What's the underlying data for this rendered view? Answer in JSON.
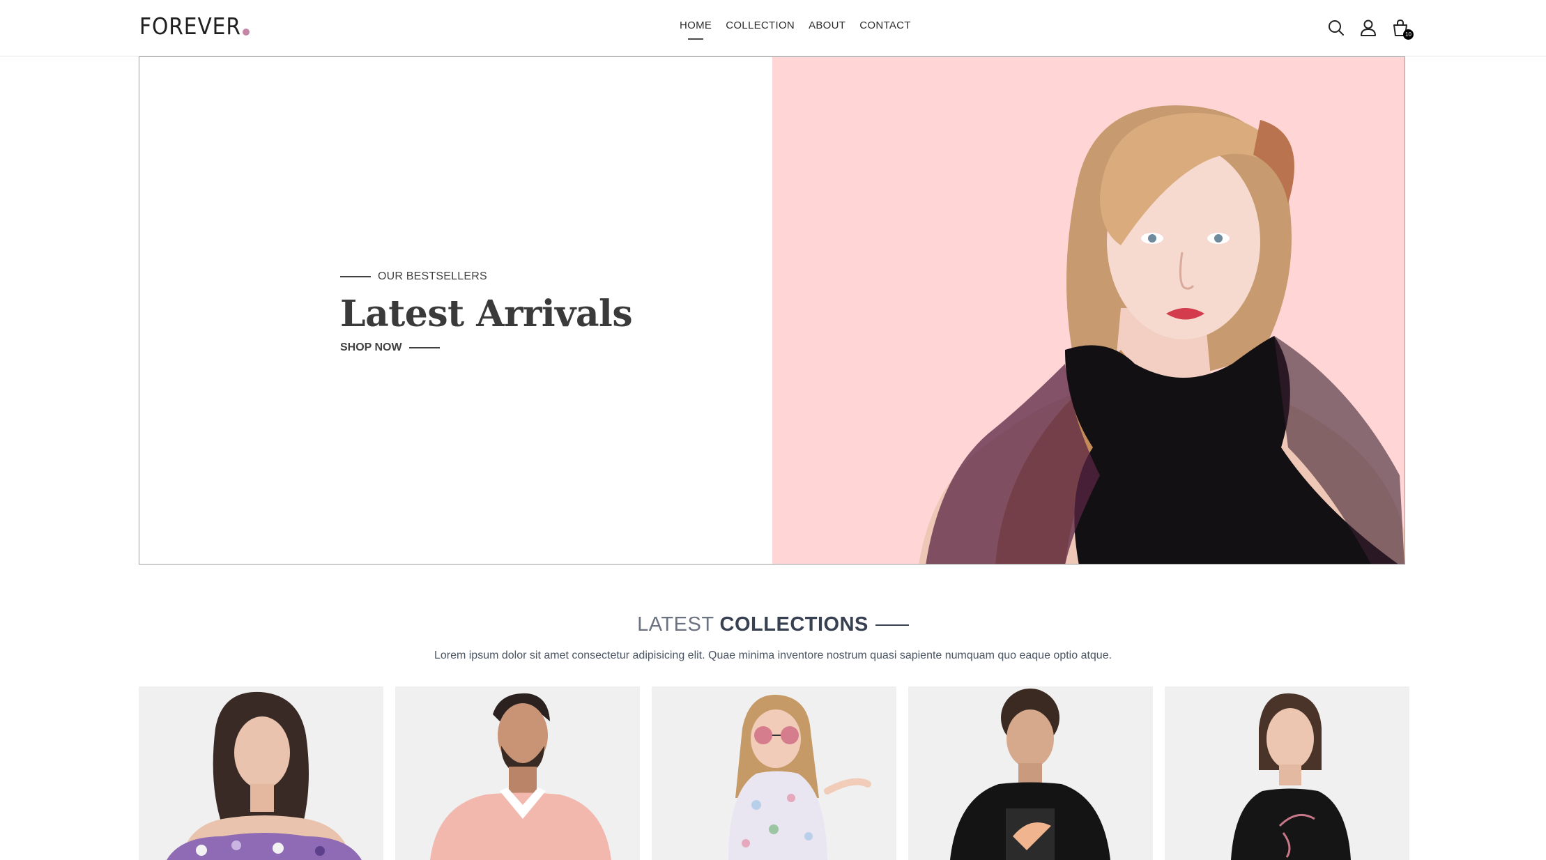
{
  "header": {
    "logo_text": "FOREVER",
    "logo_dot_color": "#c586a5",
    "nav": [
      {
        "label": "HOME",
        "active": true
      },
      {
        "label": "COLLECTION",
        "active": false
      },
      {
        "label": "ABOUT",
        "active": false
      },
      {
        "label": "CONTACT",
        "active": false
      }
    ],
    "icons": [
      "search-icon",
      "profile-icon",
      "cart-icon"
    ],
    "cart_count": "10"
  },
  "hero": {
    "eyebrow": "OUR BESTSELLERS",
    "title": "Latest Arrivals",
    "cta": "SHOP NOW",
    "image_bg_color": "#ffd6d5"
  },
  "collections": {
    "title_light": "LATEST",
    "title_bold": "COLLECTIONS",
    "description": "Lorem ipsum dolor sit amet consectetur adipisicing elit. Quae minima inventore nostrum quasi sapiente numquam quo eaque optio atque.",
    "products": [
      {
        "name": "product-1"
      },
      {
        "name": "product-2"
      },
      {
        "name": "product-3"
      },
      {
        "name": "product-4"
      },
      {
        "name": "product-5"
      }
    ]
  }
}
